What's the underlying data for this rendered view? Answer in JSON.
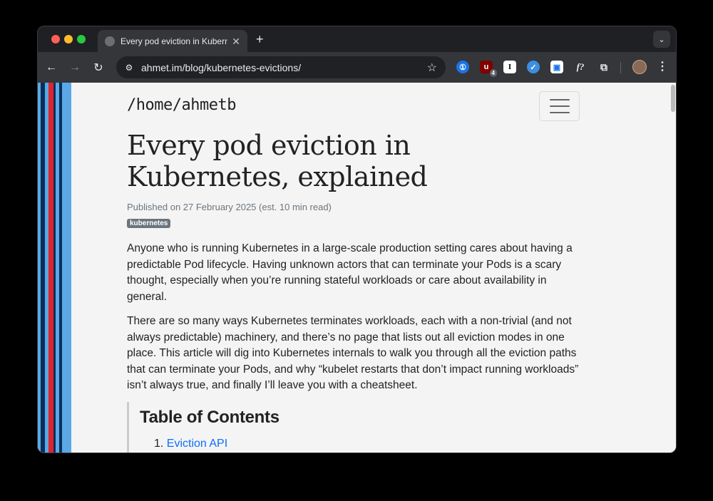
{
  "browser": {
    "tab_title": "Every pod eviction in Kubernetes, explained",
    "new_tab": "+",
    "tab_close": "✕",
    "tab_menu": "⌄",
    "url": "ahmet.im/blog/kubernetes-evictions/",
    "nav": {
      "back": "←",
      "forward": "→",
      "reload": "↻",
      "star": "☆",
      "menu": "⋮"
    },
    "extensions": [
      {
        "name": "1password-icon",
        "glyph": "①"
      },
      {
        "name": "ublock-icon",
        "glyph": "u",
        "badge": "4"
      },
      {
        "name": "instapaper-icon",
        "glyph": "I"
      },
      {
        "name": "todo-icon",
        "glyph": "✓"
      },
      {
        "name": "tab-manager-icon",
        "glyph": "▣"
      },
      {
        "name": "fx-icon",
        "glyph": "f?"
      },
      {
        "name": "extensions-puzzle-icon",
        "glyph": "⧉"
      }
    ]
  },
  "page": {
    "site_name": "/home/ahmetb",
    "title": "Every pod eviction in Kubernetes, explained",
    "published": "Published on 27 February 2025 (est. 10 min read)",
    "tag": "kubernetes",
    "paragraphs": [
      "Anyone who is running Kubernetes in a large-scale production setting cares about having a predictable Pod lifecycle. Having unknown actors that can terminate your Pods is a scary thought, especially when you’re running stateful workloads or care about availability in general.",
      "There are so many ways Kubernetes terminates workloads, each with a non-trivial (and not always predictable) machinery, and there’s no page that lists out all eviction modes in one place. This article will dig into Kubernetes internals to walk you through all the eviction paths that can terminate your Pods, and why “kubelet restarts that don’t impact running workloads” isn’t always true, and finally I’ll leave you with a cheatsheet."
    ],
    "toc": {
      "title": "Table of Contents",
      "items": [
        {
          "number": "1.",
          "label": "Eviction API"
        }
      ]
    }
  },
  "colors": {
    "stripes": [
      "#5aa9e6",
      "#0b2e59",
      "#5aa9e6",
      "#e0242e",
      "#0b2e59",
      "#5aa9e6",
      "#0b2e59",
      "#5aa9e6"
    ],
    "link": "#0d6efd",
    "tag_bg": "#6c757d"
  }
}
